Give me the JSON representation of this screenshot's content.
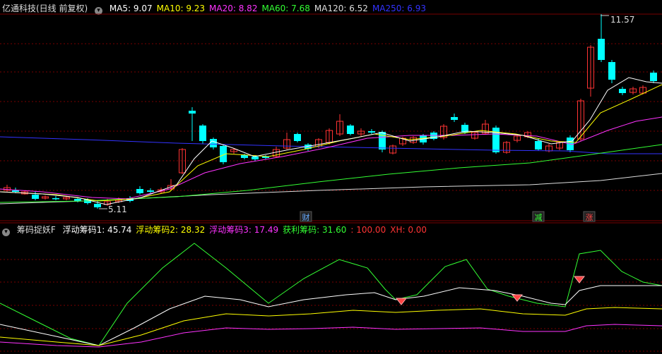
{
  "main": {
    "title": "亿通科技(日线 前复权)",
    "ma_labels": [
      {
        "text": "MA5: 9.07",
        "color": "#ffffff"
      },
      {
        "text": "MA10: 9.23",
        "color": "#ffff00"
      },
      {
        "text": "MA20: 8.82",
        "color": "#ff33ff"
      },
      {
        "text": "MA60: 7.68",
        "color": "#33ff33"
      },
      {
        "text": "MA120: 6.52",
        "color": "#dddddd"
      },
      {
        "text": "MA250: 6.93",
        "color": "#3333ff"
      }
    ],
    "high_label": "11.57",
    "low_label": "5.11",
    "markers": [
      {
        "text": "财",
        "color": "#66aaff"
      },
      {
        "text": "减",
        "color": "#33ff33"
      },
      {
        "text": "涨",
        "color": "#ff4444"
      }
    ]
  },
  "indicator": {
    "name": "筹码捉妖F",
    "labels": [
      {
        "text": "浮动筹码1: 45.74",
        "color": "#ffffff"
      },
      {
        "text": "浮动筹码2: 28.32",
        "color": "#ffff00"
      },
      {
        "text": "浮动筹码3: 17.49",
        "color": "#ff33ff"
      },
      {
        "text": "获利筹码: 31.60",
        "color": "#33ff33"
      },
      {
        "text": ": 100.00",
        "color": "#ff3333"
      },
      {
        "text": "XH: 0.00",
        "color": "#ff3333"
      }
    ]
  },
  "colors": {
    "up": "#ff3333",
    "down": "#00ffff",
    "grid": "#7a0000"
  }
}
